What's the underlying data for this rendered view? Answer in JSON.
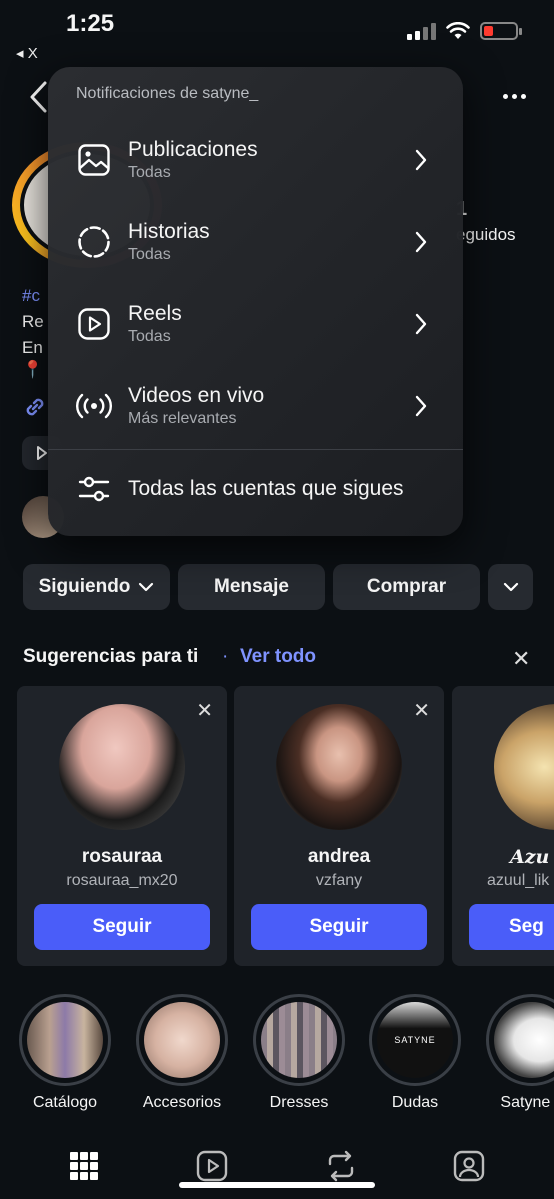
{
  "status_bar": {
    "time": "1:25",
    "back_app": "◂ X"
  },
  "profile": {
    "stat_number": "1",
    "stat_label": "eguidos",
    "bio_hash": "#c",
    "bio_line1": "Re",
    "bio_line2": "En",
    "pin": "📍"
  },
  "actions": {
    "following_label": "Siguiendo",
    "message_label": "Mensaje",
    "shop_label": "Comprar"
  },
  "suggestions": {
    "title": "Sugerencias para ti",
    "separator": "·",
    "see_all": "Ver todo",
    "close": "✕",
    "cards": [
      {
        "name": "rosauraa",
        "username": "rosauraa_mx20",
        "follow_label": "Seguir",
        "close": "✕"
      },
      {
        "name": "andrea",
        "username": "vzfany",
        "follow_label": "Seguir",
        "close": "✕"
      },
      {
        "name": "Azu",
        "username": "azuul_lik",
        "follow_label": "Seg"
      }
    ]
  },
  "highlights": [
    {
      "label": "Catálogo"
    },
    {
      "label": "Accesorios"
    },
    {
      "label": "Dresses"
    },
    {
      "label": "Dudas",
      "image_text": "SATYNE"
    },
    {
      "label": "Satyne g"
    }
  ],
  "tabs": [
    {
      "icon": "grid-icon"
    },
    {
      "icon": "reels-icon"
    },
    {
      "icon": "reposts-icon"
    },
    {
      "icon": "tagged-icon"
    }
  ],
  "menu": {
    "title": "Notificaciones de satyne_",
    "items": [
      {
        "label": "Publicaciones",
        "sub": "Todas",
        "icon": "image-icon"
      },
      {
        "label": "Historias",
        "sub": "Todas",
        "icon": "stories-icon"
      },
      {
        "label": "Reels",
        "sub": "Todas",
        "icon": "reels-icon"
      },
      {
        "label": "Videos en vivo",
        "sub": "Más relevantes",
        "icon": "live-icon"
      }
    ],
    "all_accounts": "Todas las cuentas que sigues"
  },
  "colors": {
    "background": "#0c1014",
    "accent": "#4a5df9",
    "link": "#7f93ff",
    "button": "#262a30"
  }
}
